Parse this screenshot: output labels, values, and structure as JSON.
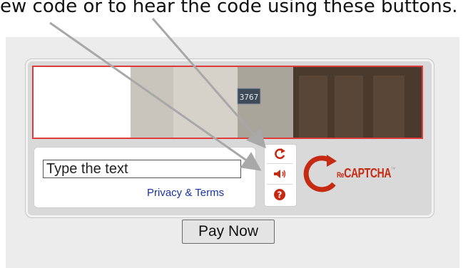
{
  "caption": "ew code or to hear the code using these buttons.",
  "captcha": {
    "challenge_image_text": "3767",
    "input_placeholder": "Type the text",
    "privacy_link": "Privacy & Terms",
    "controls": [
      {
        "name": "refresh-icon",
        "label": "Get a new challenge"
      },
      {
        "name": "audio-icon",
        "label": "Get an audio challenge"
      },
      {
        "name": "help-icon",
        "label": "Help"
      }
    ],
    "logo": {
      "prefix": "Re",
      "text": "CAPTCHA",
      "suffix": "™"
    },
    "frame_color": "#e03b3b",
    "brand_color": "#c62a12"
  },
  "pay_button": "Pay Now"
}
